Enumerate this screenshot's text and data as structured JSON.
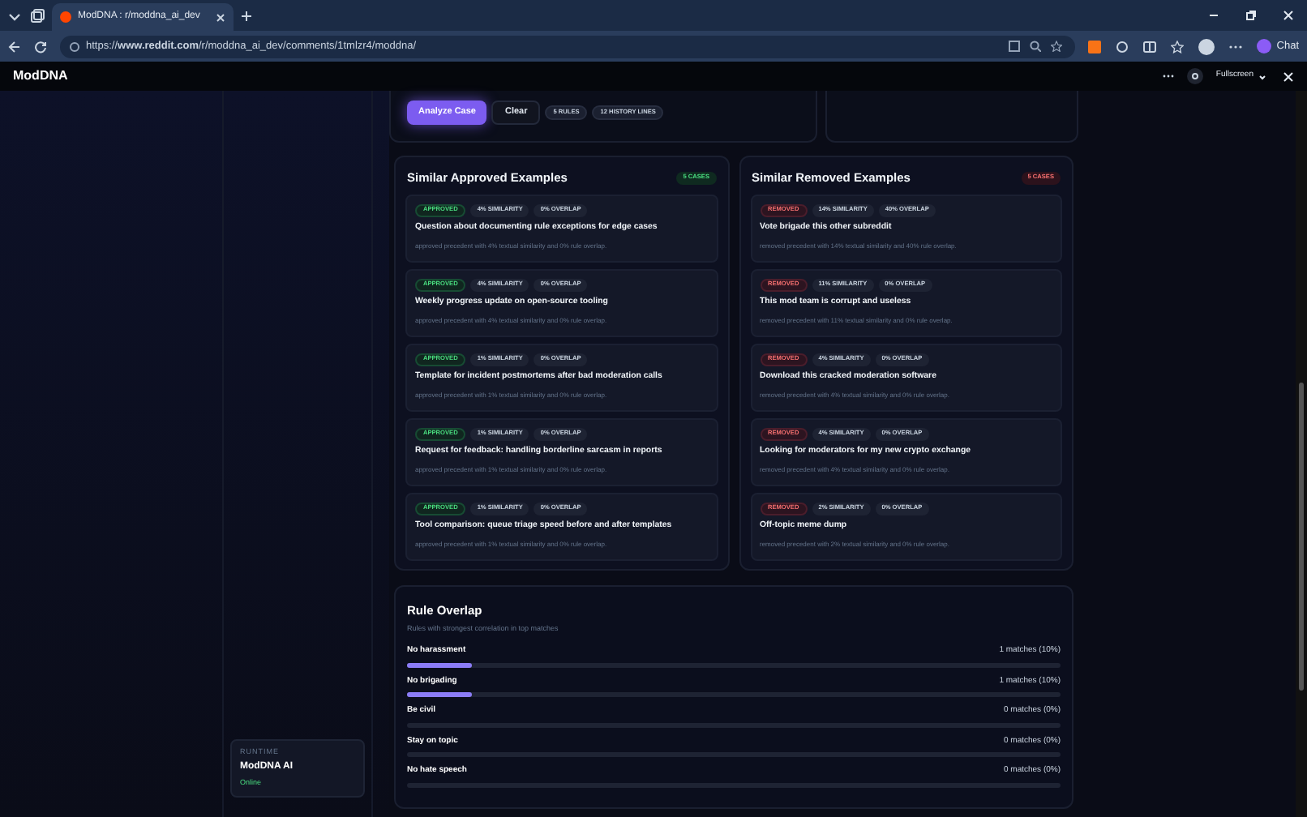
{
  "browser": {
    "tab_title": "ModDNA : r/moddna_ai_dev",
    "url": "https://**www.reddit.com**/r/moddna_ai_dev/comments/1tmlzr4/moddna/",
    "copilot_label": "Chat"
  },
  "app_header": {
    "title": "ModDNA",
    "fullscreen_label": "Fullscreen"
  },
  "actions": {
    "buttons": [
      {
        "label": "Analyze Case",
        "kind": "primary"
      },
      {
        "label": "Clear",
        "kind": "secondary"
      }
    ],
    "badges": [
      "5 RULES",
      "12 HISTORY LINES"
    ]
  },
  "similar_panels": [
    {
      "title": "Similar Approved Examples",
      "count": "5 CASES",
      "kind": "approved",
      "examples": [
        {
          "status": "APPROVED",
          "similarity": "4% SIMILARITY",
          "overlap": "0% OVERLAP",
          "title": "Question about documenting rule exceptions for edge cases",
          "description": "approved precedent with 4% textual similarity and 0% rule overlap."
        },
        {
          "status": "APPROVED",
          "similarity": "4% SIMILARITY",
          "overlap": "0% OVERLAP",
          "title": "Weekly progress update on open-source tooling",
          "description": "approved precedent with 4% textual similarity and 0% rule overlap."
        },
        {
          "status": "APPROVED",
          "similarity": "1% SIMILARITY",
          "overlap": "0% OVERLAP",
          "title": "Template for incident postmortems after bad moderation calls",
          "description": "approved precedent with 1% textual similarity and 0% rule overlap."
        },
        {
          "status": "APPROVED",
          "similarity": "1% SIMILARITY",
          "overlap": "0% OVERLAP",
          "title": "Request for feedback: handling borderline sarcasm in reports",
          "description": "approved precedent with 1% textual similarity and 0% rule overlap."
        },
        {
          "status": "APPROVED",
          "similarity": "1% SIMILARITY",
          "overlap": "0% OVERLAP",
          "title": "Tool comparison: queue triage speed before and after templates",
          "description": "approved precedent with 1% textual similarity and 0% rule overlap."
        }
      ]
    },
    {
      "title": "Similar Removed Examples",
      "count": "5 CASES",
      "kind": "removed",
      "examples": [
        {
          "status": "REMOVED",
          "similarity": "14% SIMILARITY",
          "overlap": "40% OVERLAP",
          "title": "Vote brigade this other subreddit",
          "description": "removed precedent with 14% textual similarity and 40% rule overlap."
        },
        {
          "status": "REMOVED",
          "similarity": "11% SIMILARITY",
          "overlap": "0% OVERLAP",
          "title": "This mod team is corrupt and useless",
          "description": "removed precedent with 11% textual similarity and 0% rule overlap."
        },
        {
          "status": "REMOVED",
          "similarity": "4% SIMILARITY",
          "overlap": "0% OVERLAP",
          "title": "Download this cracked moderation software",
          "description": "removed precedent with 4% textual similarity and 0% rule overlap."
        },
        {
          "status": "REMOVED",
          "similarity": "4% SIMILARITY",
          "overlap": "0% OVERLAP",
          "title": "Looking for moderators for my new crypto exchange",
          "description": "removed precedent with 4% textual similarity and 0% rule overlap."
        },
        {
          "status": "REMOVED",
          "similarity": "2% SIMILARITY",
          "overlap": "0% OVERLAP",
          "title": "Off-topic meme dump",
          "description": "removed precedent with 2% textual similarity and 0% rule overlap."
        }
      ]
    }
  ],
  "rule_overlap": {
    "title": "Rule Overlap",
    "subtitle": "Rules with strongest correlation in top matches",
    "rules": [
      {
        "name": "No harassment",
        "reading": "1 matches (10%)",
        "level": 0.1
      },
      {
        "name": "No brigading",
        "reading": "1 matches (10%)",
        "level": 0.1
      },
      {
        "name": "Be civil",
        "reading": "0 matches (0%)",
        "level": 0
      },
      {
        "name": "Stay on topic",
        "reading": "0 matches (0%)",
        "level": 0
      },
      {
        "name": "No hate speech",
        "reading": "0 matches (0%)",
        "level": 0
      }
    ]
  },
  "runtime": {
    "label": "RUNTIME",
    "name": "ModDNA AI",
    "status": "Online"
  }
}
